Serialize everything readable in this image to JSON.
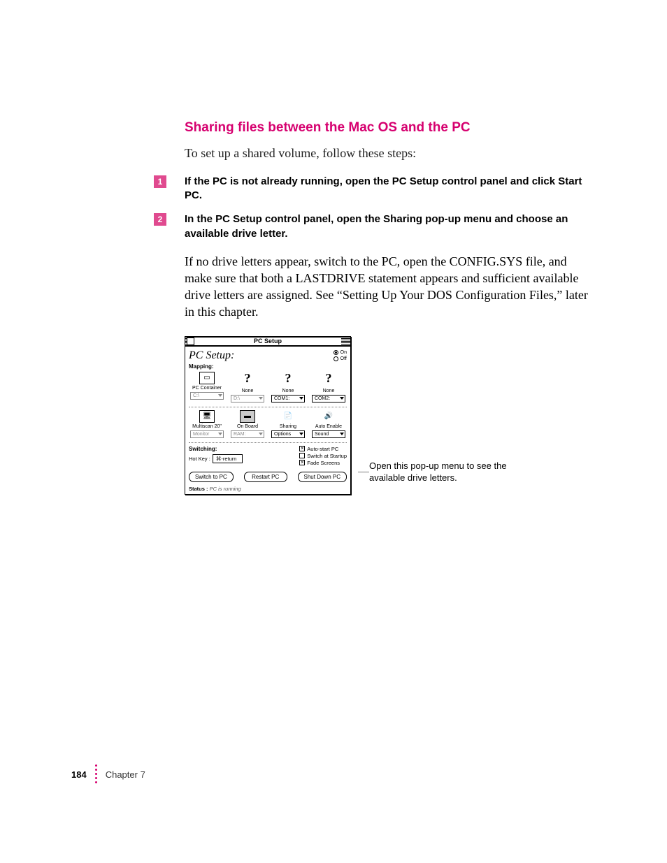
{
  "section_title": "Sharing files between the Mac OS and the PC",
  "intro": "To set up a shared volume, follow these steps:",
  "steps": [
    {
      "n": "1",
      "text": "If the PC is not already running, open the PC Setup control panel and click Start PC."
    },
    {
      "n": "2",
      "text": "In the PC Setup control panel, open the Sharing pop-up menu and choose an available drive letter."
    }
  ],
  "paragraph": "If no drive letters appear, switch to the PC, open the CONFIG.SYS file, and make sure that both a LASTDRIVE statement appears and sufficient available drive letters are assigned. See “Setting Up Your DOS Configuration Files,” later in this chapter.",
  "callout": "Open this pop-up menu to see the available drive letters.",
  "window": {
    "title": "PC Setup",
    "header": "PC Setup:",
    "on": "On",
    "off": "Off",
    "mapping_label": "Mapping:",
    "row1": [
      {
        "label": "PC Container",
        "popup": "C:\\",
        "icon": "pc"
      },
      {
        "label": "None",
        "popup": "D:\\",
        "icon": "q"
      },
      {
        "label": "None",
        "popup": "COM1:",
        "icon": "q"
      },
      {
        "label": "None",
        "popup": "COM2:",
        "icon": "q"
      }
    ],
    "row2": [
      {
        "label": "Multiscan 20\"",
        "popup": "Monitor",
        "icon": "monitor"
      },
      {
        "label": "On Board",
        "popup": "RAM:",
        "icon": "ram"
      },
      {
        "label": "Sharing",
        "popup": "Options",
        "icon": "share"
      },
      {
        "label": "Auto Enable",
        "popup": "Sound",
        "icon": "sound"
      }
    ],
    "switching_label": "Switching:",
    "hotkey_label": "Hot Key :",
    "hotkey_value": "⌘-return",
    "checks": {
      "autostart": "Auto-start PC",
      "switch_startup": "Switch at Startup",
      "fade": "Fade Screens"
    },
    "buttons": {
      "switch": "Switch to PC",
      "restart": "Restart PC",
      "shutdown": "Shut Down PC"
    },
    "status_label": "Status :",
    "status_value": "PC is running"
  },
  "footer": {
    "page": "184",
    "chapter": "Chapter 7"
  }
}
